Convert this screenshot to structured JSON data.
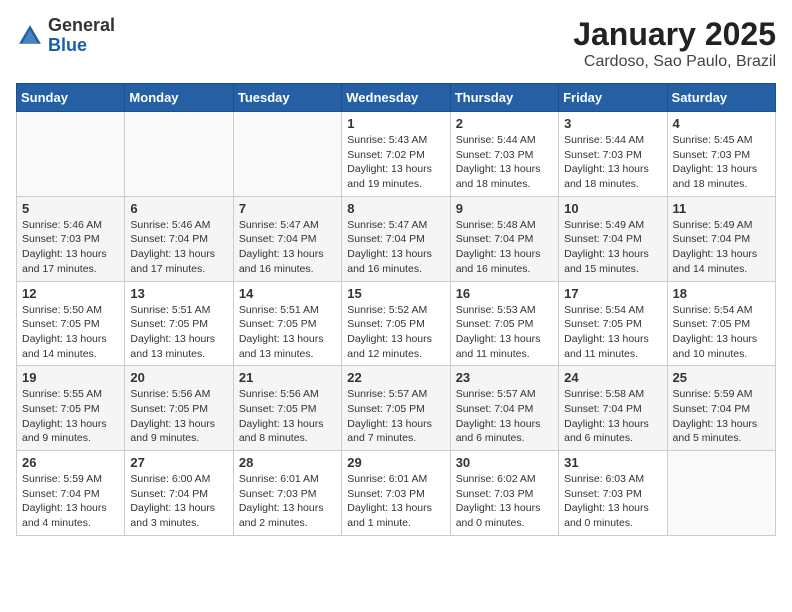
{
  "header": {
    "logo_general": "General",
    "logo_blue": "Blue",
    "month_title": "January 2025",
    "location": "Cardoso, Sao Paulo, Brazil"
  },
  "days_of_week": [
    "Sunday",
    "Monday",
    "Tuesday",
    "Wednesday",
    "Thursday",
    "Friday",
    "Saturday"
  ],
  "weeks": [
    [
      {
        "day": "",
        "content": ""
      },
      {
        "day": "",
        "content": ""
      },
      {
        "day": "",
        "content": ""
      },
      {
        "day": "1",
        "content": "Sunrise: 5:43 AM\nSunset: 7:02 PM\nDaylight: 13 hours\nand 19 minutes."
      },
      {
        "day": "2",
        "content": "Sunrise: 5:44 AM\nSunset: 7:03 PM\nDaylight: 13 hours\nand 18 minutes."
      },
      {
        "day": "3",
        "content": "Sunrise: 5:44 AM\nSunset: 7:03 PM\nDaylight: 13 hours\nand 18 minutes."
      },
      {
        "day": "4",
        "content": "Sunrise: 5:45 AM\nSunset: 7:03 PM\nDaylight: 13 hours\nand 18 minutes."
      }
    ],
    [
      {
        "day": "5",
        "content": "Sunrise: 5:46 AM\nSunset: 7:03 PM\nDaylight: 13 hours\nand 17 minutes."
      },
      {
        "day": "6",
        "content": "Sunrise: 5:46 AM\nSunset: 7:04 PM\nDaylight: 13 hours\nand 17 minutes."
      },
      {
        "day": "7",
        "content": "Sunrise: 5:47 AM\nSunset: 7:04 PM\nDaylight: 13 hours\nand 16 minutes."
      },
      {
        "day": "8",
        "content": "Sunrise: 5:47 AM\nSunset: 7:04 PM\nDaylight: 13 hours\nand 16 minutes."
      },
      {
        "day": "9",
        "content": "Sunrise: 5:48 AM\nSunset: 7:04 PM\nDaylight: 13 hours\nand 16 minutes."
      },
      {
        "day": "10",
        "content": "Sunrise: 5:49 AM\nSunset: 7:04 PM\nDaylight: 13 hours\nand 15 minutes."
      },
      {
        "day": "11",
        "content": "Sunrise: 5:49 AM\nSunset: 7:04 PM\nDaylight: 13 hours\nand 14 minutes."
      }
    ],
    [
      {
        "day": "12",
        "content": "Sunrise: 5:50 AM\nSunset: 7:05 PM\nDaylight: 13 hours\nand 14 minutes."
      },
      {
        "day": "13",
        "content": "Sunrise: 5:51 AM\nSunset: 7:05 PM\nDaylight: 13 hours\nand 13 minutes."
      },
      {
        "day": "14",
        "content": "Sunrise: 5:51 AM\nSunset: 7:05 PM\nDaylight: 13 hours\nand 13 minutes."
      },
      {
        "day": "15",
        "content": "Sunrise: 5:52 AM\nSunset: 7:05 PM\nDaylight: 13 hours\nand 12 minutes."
      },
      {
        "day": "16",
        "content": "Sunrise: 5:53 AM\nSunset: 7:05 PM\nDaylight: 13 hours\nand 11 minutes."
      },
      {
        "day": "17",
        "content": "Sunrise: 5:54 AM\nSunset: 7:05 PM\nDaylight: 13 hours\nand 11 minutes."
      },
      {
        "day": "18",
        "content": "Sunrise: 5:54 AM\nSunset: 7:05 PM\nDaylight: 13 hours\nand 10 minutes."
      }
    ],
    [
      {
        "day": "19",
        "content": "Sunrise: 5:55 AM\nSunset: 7:05 PM\nDaylight: 13 hours\nand 9 minutes."
      },
      {
        "day": "20",
        "content": "Sunrise: 5:56 AM\nSunset: 7:05 PM\nDaylight: 13 hours\nand 9 minutes."
      },
      {
        "day": "21",
        "content": "Sunrise: 5:56 AM\nSunset: 7:05 PM\nDaylight: 13 hours\nand 8 minutes."
      },
      {
        "day": "22",
        "content": "Sunrise: 5:57 AM\nSunset: 7:05 PM\nDaylight: 13 hours\nand 7 minutes."
      },
      {
        "day": "23",
        "content": "Sunrise: 5:57 AM\nSunset: 7:04 PM\nDaylight: 13 hours\nand 6 minutes."
      },
      {
        "day": "24",
        "content": "Sunrise: 5:58 AM\nSunset: 7:04 PM\nDaylight: 13 hours\nand 6 minutes."
      },
      {
        "day": "25",
        "content": "Sunrise: 5:59 AM\nSunset: 7:04 PM\nDaylight: 13 hours\nand 5 minutes."
      }
    ],
    [
      {
        "day": "26",
        "content": "Sunrise: 5:59 AM\nSunset: 7:04 PM\nDaylight: 13 hours\nand 4 minutes."
      },
      {
        "day": "27",
        "content": "Sunrise: 6:00 AM\nSunset: 7:04 PM\nDaylight: 13 hours\nand 3 minutes."
      },
      {
        "day": "28",
        "content": "Sunrise: 6:01 AM\nSunset: 7:03 PM\nDaylight: 13 hours\nand 2 minutes."
      },
      {
        "day": "29",
        "content": "Sunrise: 6:01 AM\nSunset: 7:03 PM\nDaylight: 13 hours\nand 1 minute."
      },
      {
        "day": "30",
        "content": "Sunrise: 6:02 AM\nSunset: 7:03 PM\nDaylight: 13 hours\nand 0 minutes."
      },
      {
        "day": "31",
        "content": "Sunrise: 6:03 AM\nSunset: 7:03 PM\nDaylight: 13 hours\nand 0 minutes."
      },
      {
        "day": "",
        "content": ""
      }
    ]
  ]
}
